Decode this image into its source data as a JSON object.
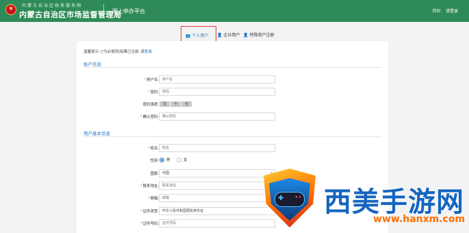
{
  "header": {
    "org_sub": "内蒙古自治区政务服务网",
    "org_main": "内蒙古自治区市场监督管理局",
    "platform": "网上申办平台",
    "greeting": "你好,",
    "login": "请登录"
  },
  "tabs": [
    {
      "label": "个人用户",
      "icon": "user-icon",
      "active": true
    },
    {
      "label": "企业用户",
      "icon": "user-icon",
      "active": false
    },
    {
      "label": "特殊用户注册",
      "icon": "user-icon",
      "active": false
    }
  ],
  "form": {
    "tip_prefix": "温馨提示: (*为必填项)如果已注册, 请",
    "tip_link": "登录",
    "section_account": "账户信息",
    "section_basic": "用户基本信息",
    "username_label": "用户名:",
    "username_placeholder": "用户名",
    "password_label": "密码:",
    "password_placeholder": "密码",
    "strength_label": "密码强度:",
    "strength_levels": [
      "弱",
      "中",
      "强"
    ],
    "confirm_label": "确认密码:",
    "confirm_placeholder": "确认密码",
    "name_label": "姓名:",
    "name_placeholder": "姓名",
    "gender_label": "性别:",
    "gender_male": "男",
    "gender_female": "女",
    "country_label": "国家:",
    "country_value": "中国",
    "address_label": "联系地址:",
    "address_placeholder": "联系地址",
    "email_label": "邮箱:",
    "email_placeholder": "邮箱",
    "idtype_label": "证件类型:",
    "idtype_value": "中华人民共和国居民身份证",
    "idnum_label": "证件号码:",
    "idnum_placeholder": "证件号码"
  },
  "watermark": {
    "title": "西美手游网",
    "url": "www.hanxm.com"
  },
  "colors": {
    "header": "#2e8b57",
    "accent": "#2a78c6",
    "highlight": "#e53935"
  }
}
